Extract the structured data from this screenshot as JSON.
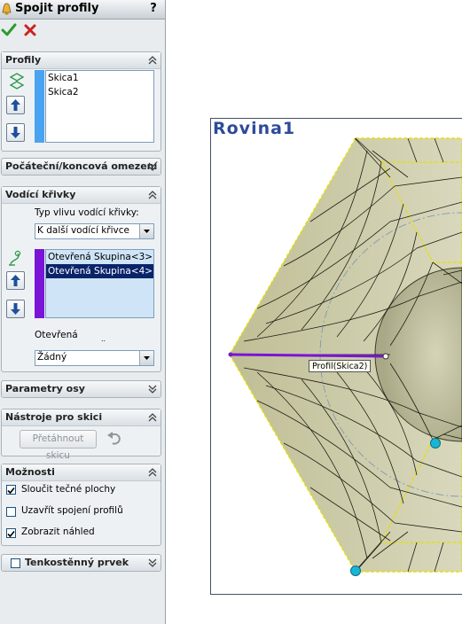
{
  "property_manager": {
    "title": "Spojit profily",
    "help_label": "?",
    "ok_icon": "checkmark-icon",
    "cancel_icon": "x-icon",
    "sections": {
      "profiles": {
        "header": "Profily",
        "items": [
          "Skica1",
          "Skica2"
        ]
      },
      "start_end": {
        "header": "Počáteční/koncová omezení"
      },
      "guides": {
        "header": "Vodící křivky",
        "influence_label": "Typ vlivu vodící křivky:",
        "influence_value": "K další vodící křivce",
        "items": [
          "Otevřená Skupina<3>",
          "Otevřená Skupina<4>"
        ],
        "selected_index": 1,
        "tangency_label": "Otevřená",
        "tangency_sublabel": "..",
        "tangency_value": "Žádný"
      },
      "axis_params": {
        "header": "Parametry osy"
      },
      "sketch_tools": {
        "header": "Nástroje pro skici",
        "drag_button": "Přetáhnout skicu"
      },
      "options": {
        "header": "Možnosti",
        "checks": [
          {
            "label": "Sloučit tečné plochy",
            "checked": true
          },
          {
            "label": "Uzavřít spojení profilů",
            "checked": false
          },
          {
            "label": "Zobrazit náhled",
            "checked": true
          }
        ]
      },
      "thin_feature": {
        "header": "Tenkostěnný prvek",
        "checked": false
      }
    }
  },
  "viewport": {
    "plane_label": "Rovina1",
    "callout": "Profil(Skica2)"
  },
  "colors": {
    "panel_bg": "#e8ecef",
    "plane_label": "#2d4b9b",
    "guide_bar": "#7a14d6",
    "profile_bar": "#4aa3f0",
    "selection": "#0a246a",
    "model_face": "#c8c7a4",
    "handle": "#18b6d4"
  }
}
